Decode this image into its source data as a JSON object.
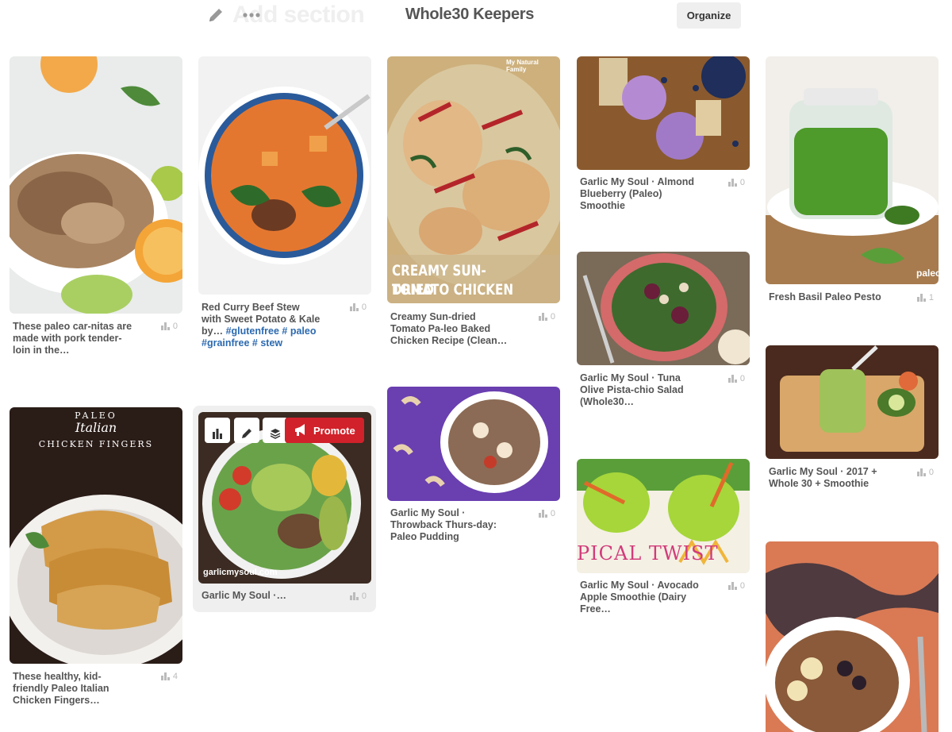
{
  "header": {
    "add_section_label": "Add section",
    "board_title": "Whole30 Keepers",
    "organize_label": "Organize"
  },
  "toolbar": {
    "promote_label": "Promote"
  },
  "pins": [
    {
      "desc": "These paleo car-nitas are made with pork tender-loin in the…",
      "count": "0"
    },
    {
      "desc": "These healthy, kid-friendly Paleo Italian Chicken Fingers…",
      "count": "4",
      "image_text": [
        "PALEO",
        "Italian",
        "CHICKEN FINGERS"
      ]
    },
    {
      "desc": "Red Curry Beef Stew with Sweet Potato & Kale by… ",
      "tags": "#glutenfree # paleo #grainfree # stew",
      "count": "0"
    },
    {
      "desc": "Garlic My Soul ·…",
      "count": "0",
      "image_caption": "garlicmysoul.com"
    },
    {
      "desc": "Creamy Sun-dried Tomato Pa-leo Baked Chicken Recipe (Clean…",
      "count": "0",
      "image_text": [
        "CREAMY SUN-DRIED",
        "TOMATO CHICKEN"
      ],
      "image_watermark": "My Natural Family"
    },
    {
      "desc": "Garlic My Soul · Throwback Thurs-day: Paleo Pudding",
      "count": "0"
    },
    {
      "desc": "Garlic My Soul · Almond Blueberry (Paleo) Smoothie",
      "count": "0"
    },
    {
      "desc": "Garlic My Soul · Tuna Olive Pista-chio Salad (Whole30…",
      "count": "0"
    },
    {
      "desc": "Garlic My Soul · Avocado Apple Smoothie (Dairy Free…",
      "count": "0",
      "image_text": [
        "PICAL TWIST"
      ]
    },
    {
      "desc": "Fresh Basil Paleo Pesto",
      "count": "1",
      "image_watermark": "paleo"
    },
    {
      "desc": "Garlic My Soul · 2017 + Whole 30 + Smoothie",
      "count": "0"
    }
  ],
  "colors": {
    "promote": "#d1212a",
    "tag_link": "#2c6ab0",
    "organize_bg": "#efefef"
  }
}
